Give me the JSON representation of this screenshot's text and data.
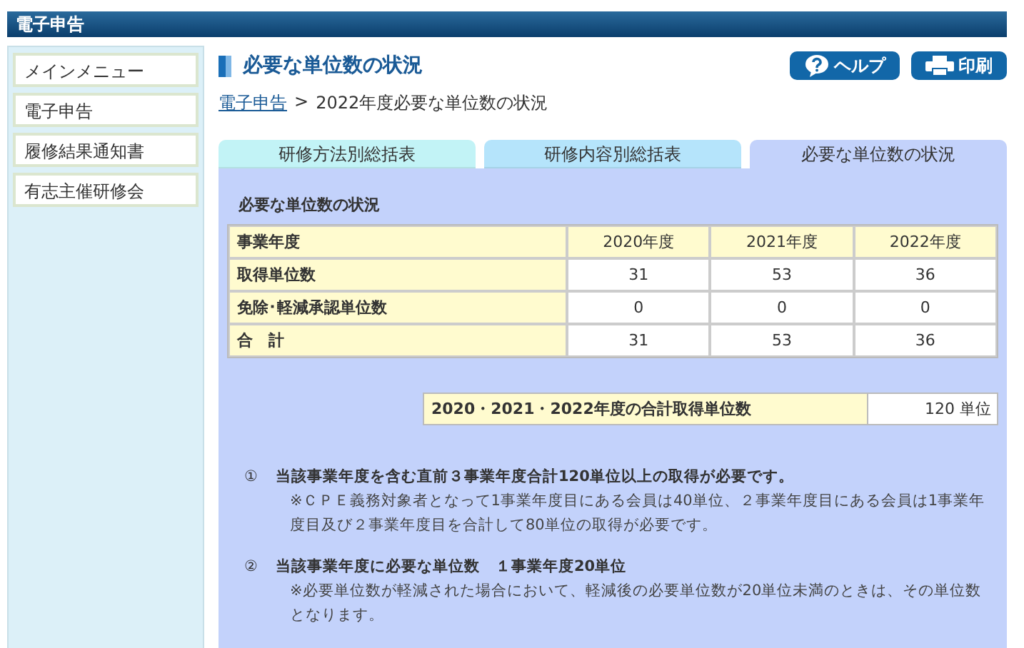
{
  "header": {
    "title": "電子申告"
  },
  "sidebar": {
    "items": [
      {
        "label": "メインメニュー"
      },
      {
        "label": "電子申告"
      },
      {
        "label": "履修結果通知書"
      },
      {
        "label": "有志主催研修会"
      }
    ]
  },
  "page": {
    "title": "必要な単位数の状況",
    "buttons": [
      {
        "kind": "help",
        "label": "ヘルプ"
      },
      {
        "kind": "print",
        "label": "印刷"
      }
    ],
    "breadcrumb": {
      "link": "電子申告",
      "separator": ">",
      "current": "2022年度必要な単位数の状況"
    }
  },
  "tabs": [
    {
      "label": "研修方法別総括表",
      "selected": false,
      "color": "#c2f3f6"
    },
    {
      "label": "研修内容別総括表",
      "selected": false,
      "color": "#b5e4fb"
    },
    {
      "label": "必要な単位数の状況",
      "selected": true,
      "color": "#c3d2fb"
    }
  ],
  "section_title": "必要な単位数の状況",
  "table": {
    "columns": [
      "事業年度",
      "2020年度",
      "2021年度",
      "2022年度"
    ],
    "rows": [
      [
        "取得単位数",
        "31",
        "53",
        "36"
      ],
      [
        "免除･軽減承認単位数",
        "0",
        "0",
        "0"
      ],
      [
        "合　計",
        "31",
        "53",
        "36"
      ]
    ]
  },
  "total": {
    "label": "2020・2021・2022年度の合計取得単位数",
    "value": "120 単位"
  },
  "notes": [
    {
      "number": "①",
      "heading": "当該事業年度を含む直前３事業年度合計120単位以上の取得が必要です。",
      "detail": "※ＣＰＥ義務対象者となって1事業年度目にある会員は40単位、２事業年度目にある会員は1事業年度目及び２事業年度目を合計して80単位の取得が必要です。"
    },
    {
      "number": "②",
      "heading": "当該事業年度に必要な単位数　１事業年度20単位",
      "detail": "※必要単位数が軽減された場合において、軽減後の必要単位数が20単位未満のときは、その単位数となります。"
    }
  ]
}
